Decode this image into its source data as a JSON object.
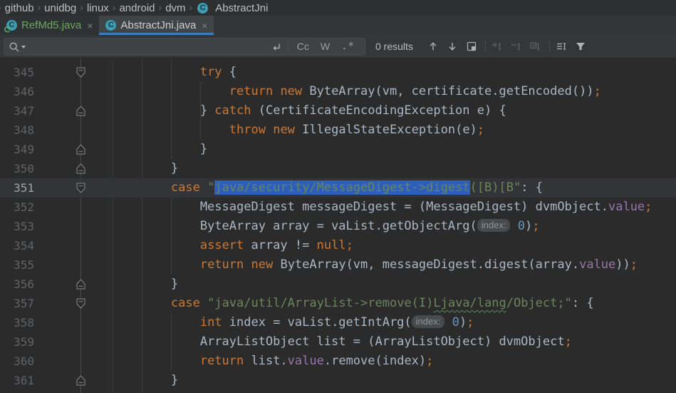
{
  "colors": {
    "editor-bg": "#2B2B2B",
    "caret-row": "#323438",
    "selection": "#2D5EBB",
    "kw": "#CC7832",
    "str": "#6A8759",
    "num": "#6897BB",
    "fld": "#9876AA",
    "def": "#A9B7C6",
    "line-num": "#606366",
    "line-num-active": "#A4A3A3",
    "breadcrumb-bg": "#2D2F30",
    "tabbar-bg": "#333639",
    "tab-active-bg": "#3F4446",
    "tab-underline": "#3A7EC0",
    "tab-added": "#6CA75F",
    "tab-text": "#CCCED0",
    "search-bg": "#34373A",
    "search-field-bg": "#3E4245",
    "icon": "#AFB3B5",
    "icon-dim": "#5F6365",
    "guide": "#3C3E40",
    "gutter-border": "#37393B",
    "connector": "#494C4E",
    "fold": "#85898B",
    "class-icon-bg": "#3E9DB2",
    "class-icon-fg": "#12333C",
    "hint-bg": "#474B4D",
    "hint-fg": "#919496",
    "squiggle": "#4E9154",
    "added-arrow": "#59A869"
  },
  "breadcrumbs": {
    "separator": "›",
    "items": [
      "github",
      "unidbg",
      "linux",
      "android",
      "dvm"
    ],
    "class_item": "AbstractJni",
    "class_icon_letter": "C"
  },
  "tabs": [
    {
      "label": "RefMd5.java",
      "close_label": "×",
      "icon": "class-icon",
      "state": "added",
      "active": false
    },
    {
      "label": "AbstractJni.java",
      "close_label": "×",
      "icon": "class-icon",
      "state": "normal",
      "active": true
    }
  ],
  "search": {
    "query": "",
    "results_label": "0 results",
    "toggles": {
      "match_case": "Cc",
      "words": "W",
      "regex": ".*"
    },
    "icons": {
      "search-icon": "⌕",
      "newline-icon": "↵",
      "prev-occurrence-icon": "↑",
      "next-occurrence-icon": "↓",
      "open-in-tool-window-icon": "❐",
      "add-occurrence-icon": "+",
      "remove-occurrence-icon": "−",
      "select-all-occurrences-icon": "☑",
      "filter-lines-icon": "≡",
      "filter-icon": "▼"
    }
  },
  "editor": {
    "lines": [
      {
        "num": "345",
        "fold": "down",
        "segments": [
          {
            "t": "            ",
            "c": "d"
          },
          {
            "t": "try",
            "c": "k"
          },
          {
            "t": " {",
            "c": "d"
          }
        ]
      },
      {
        "num": "346",
        "segments": [
          {
            "t": "                ",
            "c": "d"
          },
          {
            "t": "return",
            "c": "k"
          },
          {
            "t": " ",
            "c": "d"
          },
          {
            "t": "new",
            "c": "k"
          },
          {
            "t": " ByteArray(vm, certificate.getEncoded())",
            "c": "d"
          },
          {
            "t": ";",
            "c": "k"
          }
        ]
      },
      {
        "num": "347",
        "fold": "up",
        "segments": [
          {
            "t": "            } ",
            "c": "d"
          },
          {
            "t": "catch",
            "c": "k"
          },
          {
            "t": " (CertificateEncodingException e) {",
            "c": "d"
          }
        ]
      },
      {
        "num": "348",
        "segments": [
          {
            "t": "                ",
            "c": "d"
          },
          {
            "t": "throw",
            "c": "k"
          },
          {
            "t": " ",
            "c": "d"
          },
          {
            "t": "new",
            "c": "k"
          },
          {
            "t": " IllegalStateException(e)",
            "c": "d"
          },
          {
            "t": ";",
            "c": "k"
          }
        ]
      },
      {
        "num": "349",
        "fold": "up",
        "segments": [
          {
            "t": "            }",
            "c": "d"
          }
        ]
      },
      {
        "num": "350",
        "fold": "up",
        "segments": [
          {
            "t": "        }",
            "c": "d"
          }
        ]
      },
      {
        "num": "351",
        "fold": "down",
        "caret": true,
        "segments": [
          {
            "t": "        ",
            "c": "d"
          },
          {
            "t": "case",
            "c": "k"
          },
          {
            "t": " ",
            "c": "d"
          },
          {
            "t": "\"",
            "c": "s"
          },
          {
            "t": "java/security/MessageDigest->digest",
            "c": "s",
            "sel": true
          },
          {
            "t": "([B)[B\"",
            "c": "s"
          },
          {
            "t": ": {",
            "c": "d"
          }
        ]
      },
      {
        "num": "352",
        "segments": [
          {
            "t": "            MessageDigest messageDigest = (MessageDigest) dvmObject.",
            "c": "d"
          },
          {
            "t": "value",
            "c": "f"
          },
          {
            "t": ";",
            "c": "k"
          }
        ]
      },
      {
        "num": "353",
        "segments": [
          {
            "t": "            ByteArray array = vaList.getObjectArg(",
            "c": "d"
          },
          {
            "hint": "index:"
          },
          {
            "t": " ",
            "c": "d"
          },
          {
            "t": "0",
            "c": "n"
          },
          {
            "t": ")",
            "c": "d"
          },
          {
            "t": ";",
            "c": "k"
          }
        ]
      },
      {
        "num": "354",
        "segments": [
          {
            "t": "            ",
            "c": "d"
          },
          {
            "t": "assert",
            "c": "k"
          },
          {
            "t": " array != ",
            "c": "d"
          },
          {
            "t": "null",
            "c": "k"
          },
          {
            "t": ";",
            "c": "k"
          }
        ]
      },
      {
        "num": "355",
        "segments": [
          {
            "t": "            ",
            "c": "d"
          },
          {
            "t": "return",
            "c": "k"
          },
          {
            "t": " ",
            "c": "d"
          },
          {
            "t": "new",
            "c": "k"
          },
          {
            "t": " ByteArray(vm, messageDigest.digest(array.",
            "c": "d"
          },
          {
            "t": "value",
            "c": "f"
          },
          {
            "t": "))",
            "c": "d"
          },
          {
            "t": ";",
            "c": "k"
          }
        ]
      },
      {
        "num": "356",
        "fold": "up",
        "segments": [
          {
            "t": "        }",
            "c": "d"
          }
        ]
      },
      {
        "num": "357",
        "fold": "down",
        "segments": [
          {
            "t": "        ",
            "c": "d"
          },
          {
            "t": "case",
            "c": "k"
          },
          {
            "t": " ",
            "c": "d"
          },
          {
            "t": "\"java/util/ArrayList->remove(I)",
            "c": "s"
          },
          {
            "t": "Ljava/lang",
            "c": "s",
            "sq": true
          },
          {
            "t": "/Object;\"",
            "c": "s"
          },
          {
            "t": ": {",
            "c": "d"
          }
        ]
      },
      {
        "num": "358",
        "segments": [
          {
            "t": "            ",
            "c": "d"
          },
          {
            "t": "int",
            "c": "k"
          },
          {
            "t": " index = vaList.getIntArg(",
            "c": "d"
          },
          {
            "hint": "index:"
          },
          {
            "t": " ",
            "c": "d"
          },
          {
            "t": "0",
            "c": "n"
          },
          {
            "t": ")",
            "c": "d"
          },
          {
            "t": ";",
            "c": "k"
          }
        ]
      },
      {
        "num": "359",
        "segments": [
          {
            "t": "            ArrayListObject list = (ArrayListObject) dvmObject",
            "c": "d"
          },
          {
            "t": ";",
            "c": "k"
          }
        ]
      },
      {
        "num": "360",
        "segments": [
          {
            "t": "            ",
            "c": "d"
          },
          {
            "t": "return",
            "c": "k"
          },
          {
            "t": " list.",
            "c": "d"
          },
          {
            "t": "value",
            "c": "f"
          },
          {
            "t": ".remove(index)",
            "c": "d"
          },
          {
            "t": ";",
            "c": "k"
          }
        ]
      },
      {
        "num": "361",
        "fold": "up",
        "segments": [
          {
            "t": "        }",
            "c": "d"
          }
        ]
      }
    ]
  }
}
